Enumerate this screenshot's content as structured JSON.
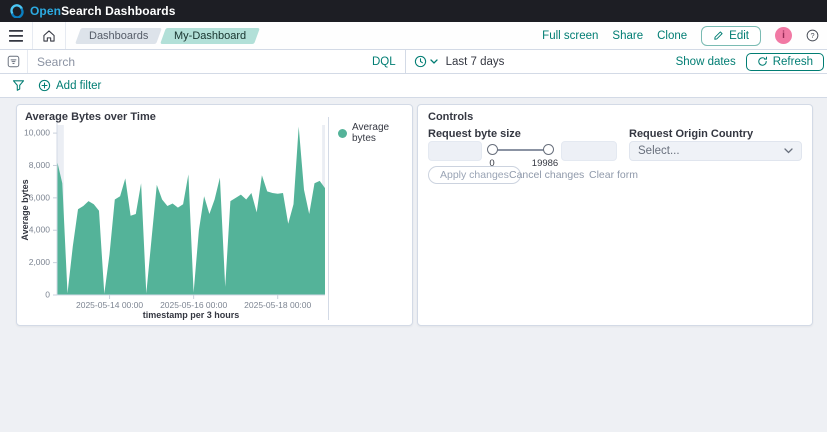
{
  "header": {
    "logo_primary": "Open",
    "logo_secondary": "Search Dashboards"
  },
  "navbar": {
    "breadcrumbs": [
      "Dashboards",
      "My-Dashboard"
    ],
    "actions": [
      "Full screen",
      "Share",
      "Clone"
    ],
    "edit_label": "Edit",
    "avatar_initial": "i"
  },
  "searchbar": {
    "placeholder": "Search",
    "language": "DQL",
    "time_range": "Last 7 days",
    "show_dates_label": "Show dates",
    "refresh_label": "Refresh"
  },
  "filterbar": {
    "add_filter_label": "Add filter"
  },
  "chart_panel": {
    "title": "Average Bytes over Time",
    "legend_label": "Average bytes"
  },
  "chart_data": {
    "type": "area",
    "title": "Average Bytes over Time",
    "xlabel": "timestamp per 3 hours",
    "ylabel": "Average bytes",
    "legend": [
      "Average bytes"
    ],
    "legend_position": "right",
    "grid": false,
    "ylim": [
      0,
      10500
    ],
    "y_ticks": [
      0,
      2000,
      4000,
      6000,
      8000,
      10000
    ],
    "x_start": "2025-05-12 18:00",
    "x_step_hours": 3,
    "x_tick_labels": [
      "2025-05-14 00:00",
      "2025-05-16 00:00",
      "2025-05-18 00:00"
    ],
    "series": [
      {
        "name": "Average bytes",
        "color": "#54B399",
        "values": [
          8300,
          6900,
          100,
          3000,
          5300,
          5500,
          5800,
          5600,
          5200,
          80,
          2500,
          5900,
          6100,
          7200,
          4900,
          5000,
          6900,
          100,
          3500,
          6800,
          5900,
          5500,
          5650,
          5400,
          5600,
          7450,
          150,
          4000,
          6100,
          5000,
          5900,
          7250,
          500,
          5800,
          6000,
          6200,
          5900,
          6300,
          5100,
          7400,
          6400,
          6300,
          6250,
          6300,
          4400,
          5600,
          10400,
          6500,
          5000,
          6900,
          7050,
          6600
        ]
      }
    ]
  },
  "controls_panel": {
    "title": "Controls",
    "byte_size": {
      "label": "Request byte size",
      "min_value": "",
      "max_value": "",
      "range_min_label": "0",
      "range_max_label": "19986"
    },
    "country": {
      "label": "Request Origin Country",
      "selected": "Select..."
    },
    "buttons": {
      "apply": "Apply changes",
      "cancel": "Cancel changes",
      "clear": "Clear form"
    }
  },
  "colors": {
    "accent_teal": "#017D73",
    "chart_green": "#54B399",
    "header_bg": "#1D1E24",
    "panel_border": "#D3DAE6",
    "page_bg": "#EEF0F4",
    "breadcrumb_active_bg": "#B2E0D8",
    "avatar_bg": "#F179A4"
  },
  "icons": {
    "opensearch-logo-icon": "swirl",
    "menu-icon": "hamburger",
    "home-icon": "house",
    "pencil-icon": "pencil",
    "help-icon": "question-circle",
    "saved-queries-icon": "filter-box",
    "clock-icon": "clock",
    "chevron-down-icon": "chevron-down",
    "refresh-icon": "circular-arrow",
    "filter-icon": "funnel",
    "plus-circle-icon": "circled-plus"
  }
}
